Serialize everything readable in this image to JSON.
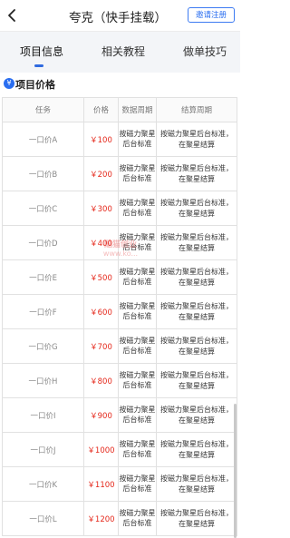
{
  "header": {
    "title": "夸克（快手挂载）",
    "invite_label": "邀请注册"
  },
  "tabs": [
    {
      "label": "项目信息",
      "active": true
    },
    {
      "label": "相关教程",
      "active": false
    },
    {
      "label": "做单技巧",
      "active": false
    }
  ],
  "section": {
    "icon": "yen-icon",
    "title": "项目价格"
  },
  "table": {
    "headers": [
      "任务",
      "价格",
      "数据周期",
      "结算周期"
    ],
    "rows": [
      {
        "task": "一口价A",
        "price": "￥100",
        "data_period": "按磁力聚星后台标准",
        "settle_period": "按磁力聚星后台标准，在聚星结算"
      },
      {
        "task": "一口价B",
        "price": "￥200",
        "data_period": "按磁力聚星后台标准",
        "settle_period": "按磁力聚星后台标准，在聚星结算"
      },
      {
        "task": "一口价C",
        "price": "￥300",
        "data_period": "按磁力聚星后台标准",
        "settle_period": "按磁力聚星后台标准，在聚星结算"
      },
      {
        "task": "一口价D",
        "price": "￥400",
        "data_period": "按磁力聚星后台标准",
        "settle_period": "按磁力聚星后台标准，在聚星结算"
      },
      {
        "task": "一口价E",
        "price": "￥500",
        "data_period": "按磁力聚星后台标准",
        "settle_period": "按磁力聚星后台标准，在聚星结算"
      },
      {
        "task": "一口价F",
        "price": "￥600",
        "data_period": "按磁力聚星后台标准",
        "settle_period": "按磁力聚星后台标准，在聚星结算"
      },
      {
        "task": "一口价G",
        "price": "￥700",
        "data_period": "按磁力聚星后台标准",
        "settle_period": "按磁力聚星后台标准，在聚星结算"
      },
      {
        "task": "一口价H",
        "price": "￥800",
        "data_period": "按磁力聚星后台标准",
        "settle_period": "按磁力聚星后台标准，在聚星结算"
      },
      {
        "task": "一口价I",
        "price": "￥900",
        "data_period": "按磁力聚星后台标准",
        "settle_period": "按磁力聚星后台标准，在聚星结算"
      },
      {
        "task": "一口价J",
        "price": "￥1000",
        "data_period": "按磁力聚星后台标准",
        "settle_period": "按磁力聚星后台标准，在聚星结算"
      },
      {
        "task": "一口价K",
        "price": "￥1100",
        "data_period": "按磁力聚星后台标准",
        "settle_period": "按磁力聚星后台标准，在聚星结算"
      },
      {
        "task": "一口价L",
        "price": "￥1200",
        "data_period": "按磁力聚星后台标准",
        "settle_period": "按磁力聚星后台标准，在聚星结算"
      }
    ]
  },
  "watermark": {
    "line1": "酷猫创业",
    "line2": "www.ko..."
  },
  "colors": {
    "accent": "#2a6ef0",
    "price": "#e5281b",
    "tab_bg": "#f3f5f8"
  }
}
